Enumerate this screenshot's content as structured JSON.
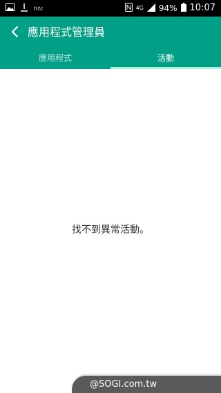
{
  "status_bar": {
    "carrier_brand": "htc",
    "network": "4G",
    "battery": "94%",
    "time": "10:07",
    "icons": [
      "image-icon",
      "download-icon",
      "nfc-icon",
      "signal-icon",
      "battery-icon"
    ]
  },
  "app_bar": {
    "title": "應用程式管理員",
    "back_icon": "chevron-left-icon",
    "color": "#009f86"
  },
  "tabs": [
    {
      "label": "應用程式",
      "active": false
    },
    {
      "label": "活動",
      "active": true
    }
  ],
  "main": {
    "empty_message": "找不到異常活動。"
  },
  "watermark": {
    "text": "@SOGI.com.tw"
  }
}
